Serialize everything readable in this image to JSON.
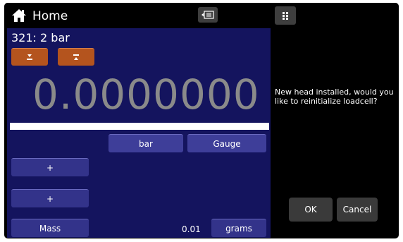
{
  "topbar": {
    "title": "Home"
  },
  "channel": {
    "label": "321:  2 bar"
  },
  "display": {
    "reading": "0.0000000"
  },
  "buttons": {
    "unit": "bar",
    "mode": "Gauge",
    "plus1": "+",
    "plus2": "+",
    "mass": "Mass",
    "mass_value": "0.01",
    "mass_unit": "grams"
  },
  "dialog": {
    "message": "New head installed, would you like to reinitialize loadcell?",
    "ok": "OK",
    "cancel": "Cancel"
  },
  "colors": {
    "panel": "#14145e",
    "button": "#3e3e99",
    "tare": "#b4541e"
  }
}
